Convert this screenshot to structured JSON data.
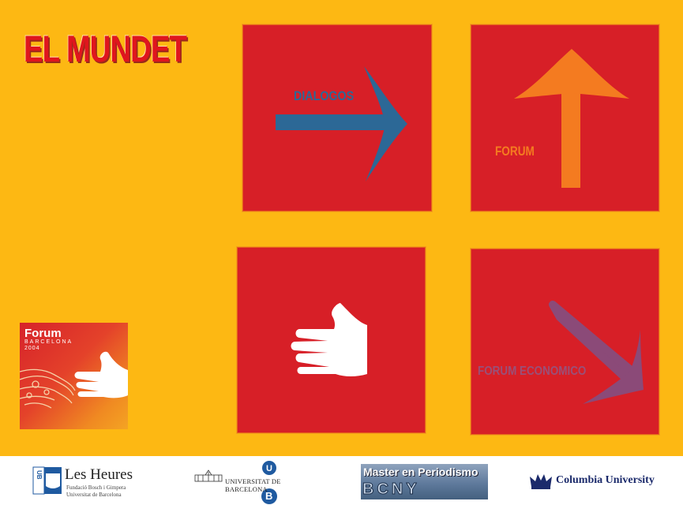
{
  "site": {
    "title": "EL MUNDET"
  },
  "tiles": {
    "dialogos": {
      "label": "DIALOGOS",
      "arrow_color": "#2c6896",
      "label_color": "#2c6896"
    },
    "forum": {
      "label": "FORUM",
      "arrow_color": "#f47b20",
      "label_color": "#f47b20"
    },
    "hand": {
      "icon": "hand-icon"
    },
    "forum_economico": {
      "label": "FORUM ECONOMICO",
      "arrow_color": "#8b4a78",
      "label_color": "#9a5078"
    }
  },
  "forum_logo": {
    "line1": "Forum",
    "line2": "BARCELONA",
    "line3": "2004"
  },
  "sponsors": {
    "les_heures": {
      "name": "Les Heures",
      "line1": "Fundació Bosch i Gimpera",
      "line2": "Universitat de Barcelona",
      "mark": "UB"
    },
    "ub": {
      "name": "UNIVERSITAT DE BARCELONA",
      "mark": "B"
    },
    "master": {
      "line1": "Master en Periodismo",
      "line2": "BCNY"
    },
    "columbia": {
      "name": "Columbia University"
    }
  },
  "colors": {
    "background": "#fdb813",
    "tile": "#d71f27",
    "title": "#e0161d"
  }
}
